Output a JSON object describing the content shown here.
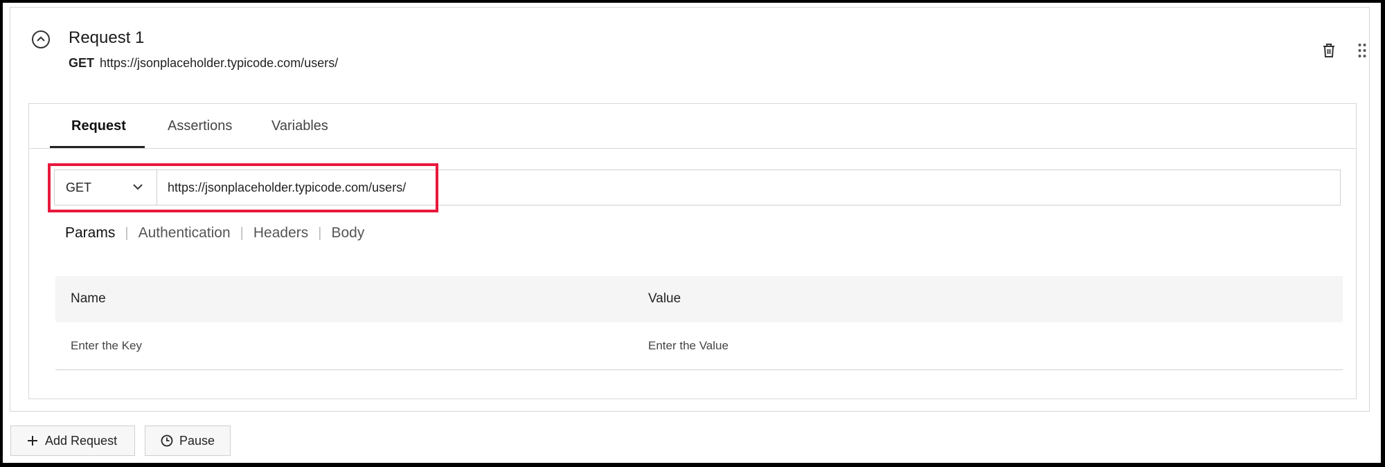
{
  "request": {
    "title": "Request 1",
    "method": "GET",
    "url": "https://jsonplaceholder.typicode.com/users/"
  },
  "tabs": [
    {
      "label": "Request"
    },
    {
      "label": "Assertions"
    },
    {
      "label": "Variables"
    }
  ],
  "urlbar": {
    "method": "GET",
    "url": "https://jsonplaceholder.typicode.com/users/"
  },
  "subtabs": [
    {
      "label": "Params"
    },
    {
      "label": "Authentication"
    },
    {
      "label": "Headers"
    },
    {
      "label": "Body"
    }
  ],
  "params_table": {
    "headers": [
      "Name",
      "Value"
    ],
    "key_placeholder": "Enter the Key",
    "value_placeholder": "Enter the Value"
  },
  "footer": {
    "add_request_label": "Add Request",
    "pause_label": "Pause"
  },
  "colors": {
    "highlight": "#e8183c",
    "border": "#d6d6d6"
  },
  "icons": [
    "chevron-up-circle-icon",
    "trash-icon",
    "drag-handle-icon",
    "chevron-down-icon",
    "plus-icon",
    "clock-icon"
  ]
}
